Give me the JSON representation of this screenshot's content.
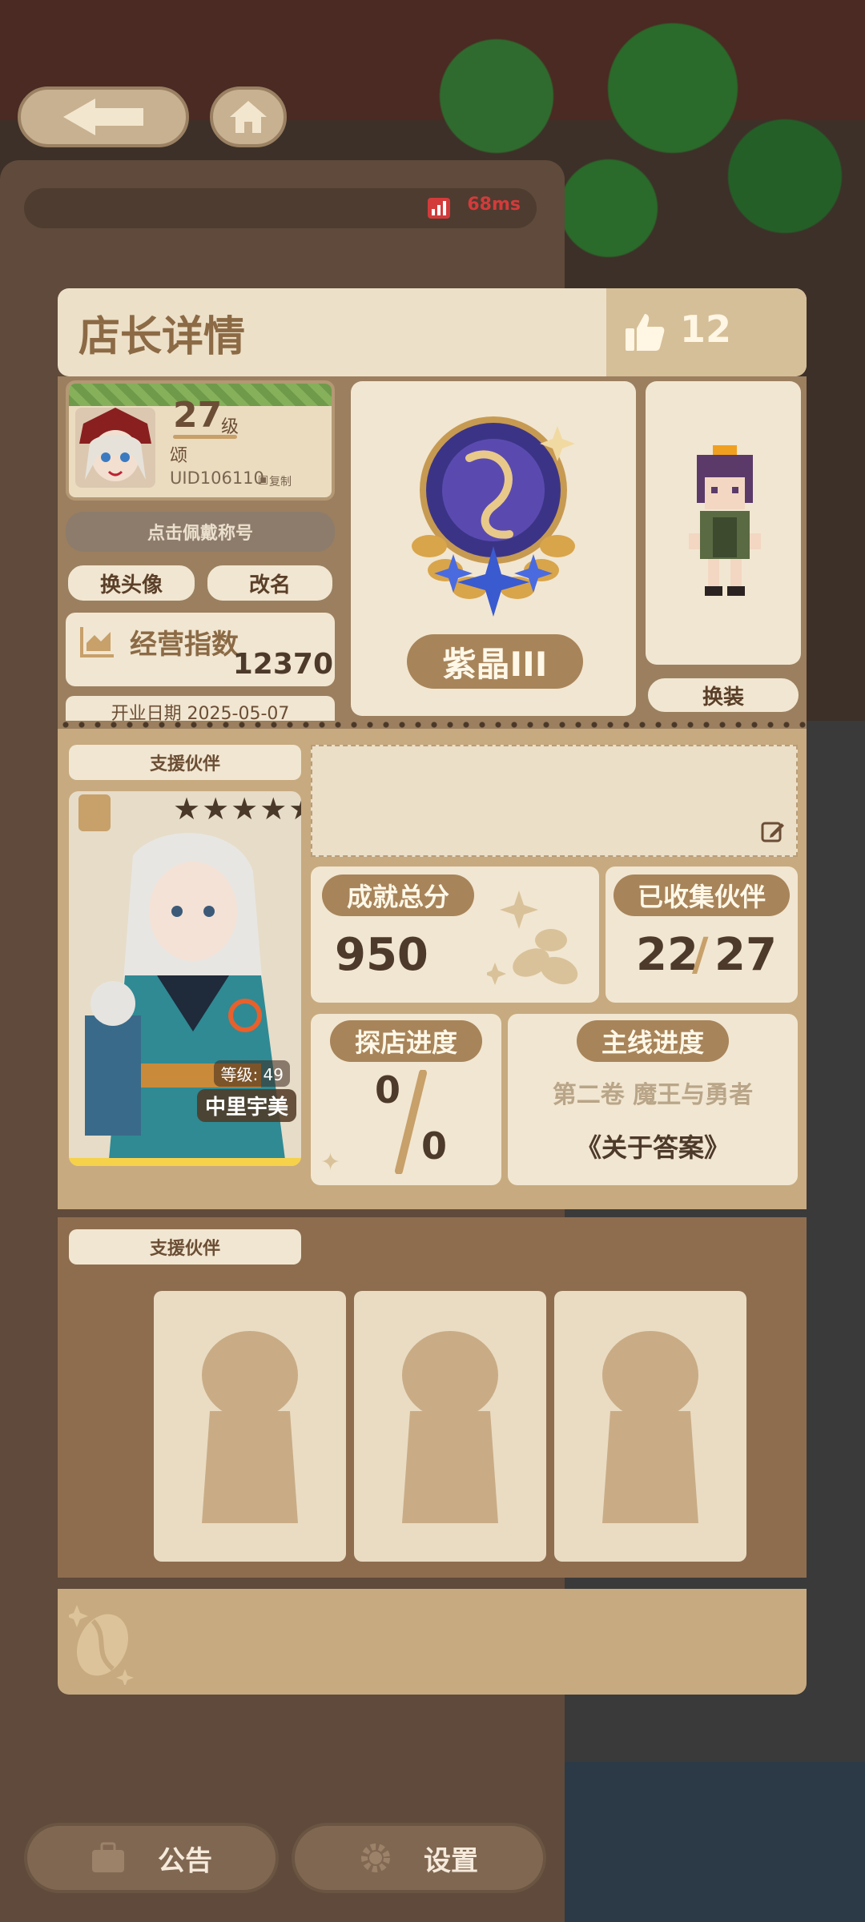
{
  "topbar": {
    "ping": "68ms"
  },
  "dialog": {
    "title": "店长详情",
    "likes": "12",
    "profile": {
      "level": "27",
      "level_unit": "级",
      "name": "颂",
      "uid": "UID106110",
      "copy_label": "复制",
      "title_badge": "点击佩戴称号",
      "change_avatar": "换头像",
      "rename": "改名",
      "business_label": "经营指数",
      "business_value": "12370",
      "open_date": "开业日期 2025-05-07"
    },
    "medal": {
      "name": "紫晶III"
    },
    "costume_button": "换装",
    "partner": {
      "label": "支援伙伴",
      "stars": "★★★★★",
      "level": "等级: 49",
      "name": "中里宇美"
    },
    "stats": {
      "achievement_label": "成就总分",
      "achievement_value": "950",
      "collected_label": "已收集伙伴",
      "collected_have": "22",
      "collected_total": "27",
      "explore_label": "探店进度",
      "explore_have": "0",
      "explore_total": "0",
      "main_label": "主线进度",
      "main_chapter": "第二卷 魔王与勇者",
      "main_quest": "《关于答案》"
    },
    "support": {
      "label": "支援伙伴"
    }
  },
  "bottom": {
    "notice": "公告",
    "settings": "设置"
  }
}
